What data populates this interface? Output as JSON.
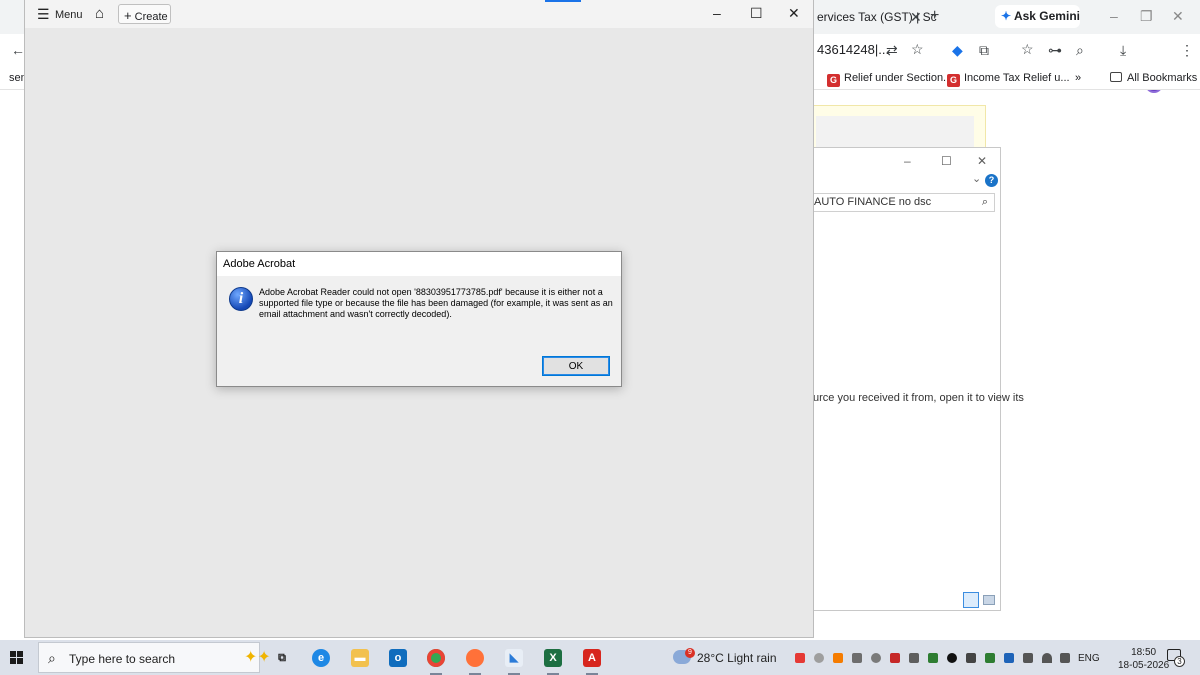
{
  "browser": {
    "tab_text": "ervices Tax (GST) | Sc",
    "gemini_label": "Ask Gemini",
    "url_fragment": "43614248|...",
    "sidebar_fragment": "sen",
    "bookmarks": [
      {
        "label": "Relief under Section..."
      },
      {
        "label": "Income Tax Relief u..."
      }
    ],
    "more_bookmarks": "»",
    "all_bookmarks": "All Bookmarks"
  },
  "explorer": {
    "search_value": "AUTO FINANCE no dsc",
    "message_fragment": "urce you received it from, open it to view its"
  },
  "acrobat": {
    "menu_label": "Menu",
    "create_label": "Create"
  },
  "dialog": {
    "title": "Adobe Acrobat",
    "message": "Adobe Acrobat Reader could not open '88303951773785.pdf' because it is either not a supported file type or because the file has been damaged (for example, it was sent as an email attachment and wasn't correctly decoded).",
    "ok_label": "OK"
  },
  "taskbar": {
    "search_placeholder": "Type here to search",
    "weather_text": "28°C  Light rain",
    "weather_badge": "9",
    "language": "ENG",
    "time": "18:50",
    "date": "18-05-2026",
    "notification_count": "3"
  },
  "colors": {
    "accent": "#0078d7",
    "dialog_bg": "#f0f0f0",
    "acrobat_bg": "#e8e8e8",
    "taskbar_bg": "#dce1ea"
  }
}
